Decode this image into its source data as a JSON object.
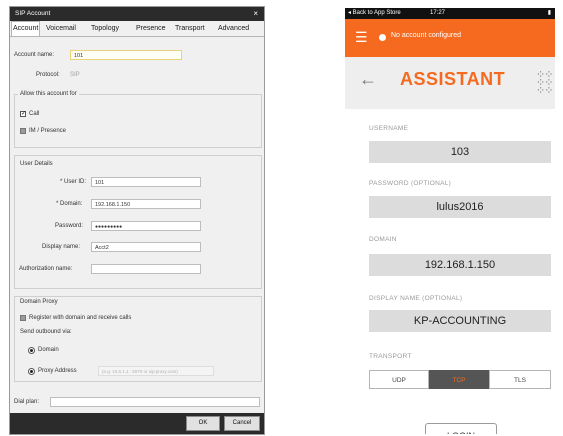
{
  "sip_dialog": {
    "title": "SIP Account",
    "close_glyph": "×",
    "tabs": [
      "Account",
      "Voicemail",
      "Topology",
      "Presence",
      "Transport",
      "Advanced"
    ],
    "account_name_label": "Account name:",
    "account_name_value": "101",
    "protocol_label": "Protocol:",
    "protocol_value": "SIP",
    "allow_group_title": "Allow this account for",
    "call_label": "Call",
    "im_label": "IM / Presence",
    "user_details_title": "User Details",
    "user_id_label": "* User ID:",
    "user_id_value": "101",
    "domain_label": "* Domain:",
    "domain_value": "192.168.1.150",
    "password_label": "Password:",
    "password_value": "●●●●●●●●●",
    "display_name_label": "Display name:",
    "display_name_value": "Acct2",
    "auth_name_label": "Authorization name:",
    "auth_name_value": "",
    "domain_proxy_title": "Domain Proxy",
    "register_label": "Register with domain and receive calls",
    "send_outbound_label": "Send outbound via:",
    "radio_domain_label": "Domain",
    "radio_proxy_label": "Proxy   Address",
    "proxy_placeholder": "(e.g. 10.6.1.1 : 5070 or sip:proxy.com)",
    "dial_plan_label": "Dial plan:",
    "ok_label": "OK",
    "cancel_label": "Cancel"
  },
  "mobile": {
    "status_left": "◂ Back to App Store",
    "status_time": "17:27",
    "status_right": "▮",
    "menu_icon": "☰",
    "no_account_text": "No account configured",
    "back_arrow": "←",
    "title": "ASSISTANT",
    "grid_icon": "⋮⋮⋮",
    "username_label": "USERNAME",
    "username_value": "103",
    "password_label": "PASSWORD (OPTIONAL)",
    "password_value": "lulus2016",
    "domain_label": "DOMAIN",
    "domain_value": "192.168.1.150",
    "display_name_label": "DISPLAY NAME (OPTIONAL)",
    "display_name_value": "KP-ACCOUNTING",
    "transport_label": "TRANSPORT",
    "transport_options": [
      "UDP",
      "TCP",
      "TLS"
    ],
    "transport_selected": "TCP",
    "login_label": "LOGIN"
  },
  "colors": {
    "accent_orange": "#f56a1f",
    "dialog_title_bar": "#2b2b2b",
    "mobile_field_bg": "#dcdcdc"
  }
}
